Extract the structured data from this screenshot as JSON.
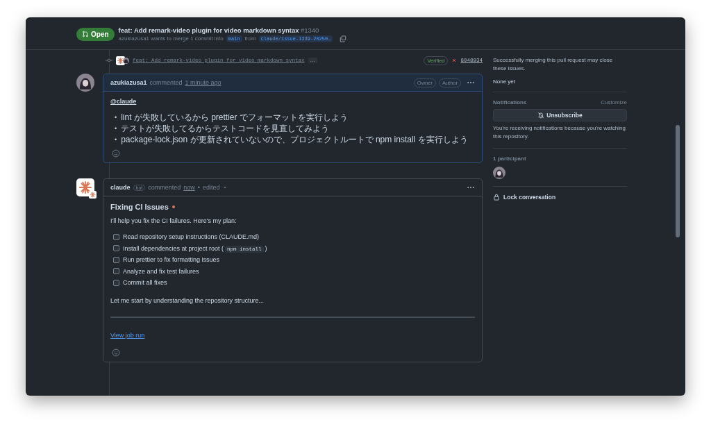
{
  "header": {
    "state": "Open",
    "title": "feat: Add remark-video plugin for video markdown syntax",
    "number": "#1340",
    "author": "azukiazusa1",
    "merge_text": "wants to merge 1 commit into",
    "base": "main",
    "from": "from",
    "head": "claude/issue-1339-20250…"
  },
  "commit": {
    "message": "feat: Add remark-video plugin for video markdown syntax",
    "more": "…",
    "verified": "Verified",
    "failed": true,
    "sha": "8048934"
  },
  "comments": [
    {
      "author": "azukiazusa1",
      "action": "commented",
      "time": "1 minute ago",
      "badges": [
        "Owner",
        "Author"
      ],
      "highlighted": true,
      "body": [
        {
          "kind": "mention",
          "text": "@claude"
        },
        {
          "kind": "list",
          "bullet": "•",
          "items": [
            "lint が失敗しているから prettier でフォーマットを実行しよう",
            "テストが失敗してるからテストコードを見直してみよう",
            "package-lock.json が更新されていないので、プロジェクトルートで npm install を実行しよう"
          ]
        }
      ]
    },
    {
      "author": "claude",
      "bot_label": "bot",
      "action": "commented",
      "time": "now",
      "separator": "•",
      "edited": "edited",
      "highlighted": false,
      "body": [
        {
          "kind": "heading",
          "text": "Fixing CI Issues",
          "spinner": true
        },
        {
          "kind": "paragraph",
          "text": "I'll help you fix the CI failures. Here's my plan:"
        },
        {
          "kind": "tasks",
          "items": [
            {
              "text": "Read repository setup instructions (CLAUDE.md)",
              "checked": false
            },
            {
              "text": "Install dependencies at project root (",
              "code": "npm install",
              "after": ")",
              "checked": false
            },
            {
              "text": "Run prettier to fix formatting issues",
              "checked": false
            },
            {
              "text": "Analyze and fix test failures",
              "checked": false
            },
            {
              "text": "Commit all fixes",
              "checked": false
            }
          ]
        },
        {
          "kind": "paragraph",
          "text": "Let me start by understanding the repository structure..."
        },
        {
          "kind": "rule"
        },
        {
          "kind": "link",
          "text": "View job run"
        }
      ]
    }
  ],
  "sidebar": {
    "development_note": "Successfully merging this pull request may close these issues.",
    "development_value": "None yet",
    "notifications_title": "Notifications",
    "customize": "Customize",
    "unsubscribe": "Unsubscribe",
    "notifications_note": "You're receiving notifications because you're watching this repository.",
    "participants_title": "1 participant",
    "lock": "Lock conversation"
  }
}
